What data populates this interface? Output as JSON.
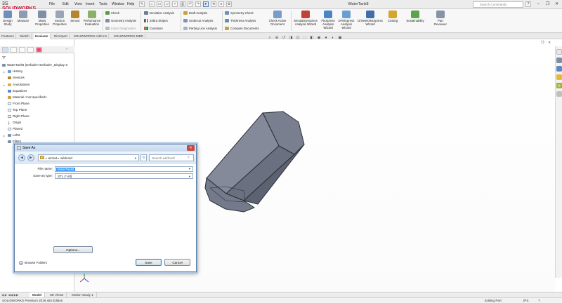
{
  "app": {
    "logo_brand": "3S",
    "logo_text": "SOLIDWORKS",
    "document_title": "WaterTank8",
    "search_placeholder": "Search Commands",
    "menu": [
      "File",
      "Edit",
      "View",
      "Insert",
      "Tools",
      "Window",
      "Help"
    ]
  },
  "ribbon": {
    "design_study": "Design Study",
    "measure": "Measure",
    "mass_properties": "Mass Properties",
    "section_properties": "Section Properties",
    "sensor": "Sensor",
    "performance_evaluation": "Performance Evaluation",
    "check": "Check",
    "geometry_analysis": "Geometry Analysis",
    "import_diagnostics": "Import Diagnostics",
    "deviation_analysis": "Deviation Analysis",
    "zebra_stripes": "Zebra Stripes",
    "curvature": "Curvature",
    "draft_analysis": "Draft Analysis",
    "undercut_analysis": "Undercut Analysis",
    "parting_line_analysis": "Parting Line Analysis",
    "symmetry_check": "Symmetry Check",
    "thickness_analysis": "Thickness Analysis",
    "compare_documents": "Compare Documents",
    "check_active_document": "Check Active Document",
    "simulationxpress": "SimulationXpress Analysis Wizard",
    "floxpress": "FloXpress Analysis Wizard",
    "dfmxpress": "DFMXpress Analysis Wizard",
    "driveworksxpress": "DriveWorksXpress Wizard",
    "costing": "Costing",
    "sustainability": "Sustainability",
    "part_reviewer": "Part Reviewer"
  },
  "command_tabs": [
    "Features",
    "Sketch",
    "Evaluate",
    "DimXpert",
    "SOLIDWORKS Add-Ins",
    "SOLIDWORKS MBD"
  ],
  "active_command_tab": "Evaluate",
  "tree": {
    "root": "WaterTank8  (Default<<Default>_Display S",
    "items": [
      "History",
      "Sensors",
      "Annotations",
      "Equations",
      "Material <not specified>",
      "Front Plane",
      "Top Plane",
      "Right Plane",
      "Origin",
      "Plane2",
      "Loft3",
      "Fillet1"
    ]
  },
  "dialog": {
    "title": "Save As",
    "path": [
      "azmat",
      "wildcard"
    ],
    "search_placeholder": "Search wildcard",
    "file_name_label": "File name:",
    "file_name_value": "WaterTank8",
    "save_as_type_label": "Save as type:",
    "save_as_type_value": "STL (*.stl)",
    "options_label": "Options...",
    "browse_folders_label": "Browse Folders",
    "save_label": "Save",
    "cancel_label": "Cancel"
  },
  "bottom_tabs": [
    "Model",
    "3D Views",
    "Motion Study 1"
  ],
  "active_bottom_tab": "Model",
  "status": {
    "edition": "SOLIDWORKS Premium 2016 x64 Edition",
    "editing": "Editing Part",
    "units": "IPS"
  },
  "colors": {
    "accent": "#3399ff",
    "brand": "#c8102e",
    "model_body": "#6a6f80"
  }
}
